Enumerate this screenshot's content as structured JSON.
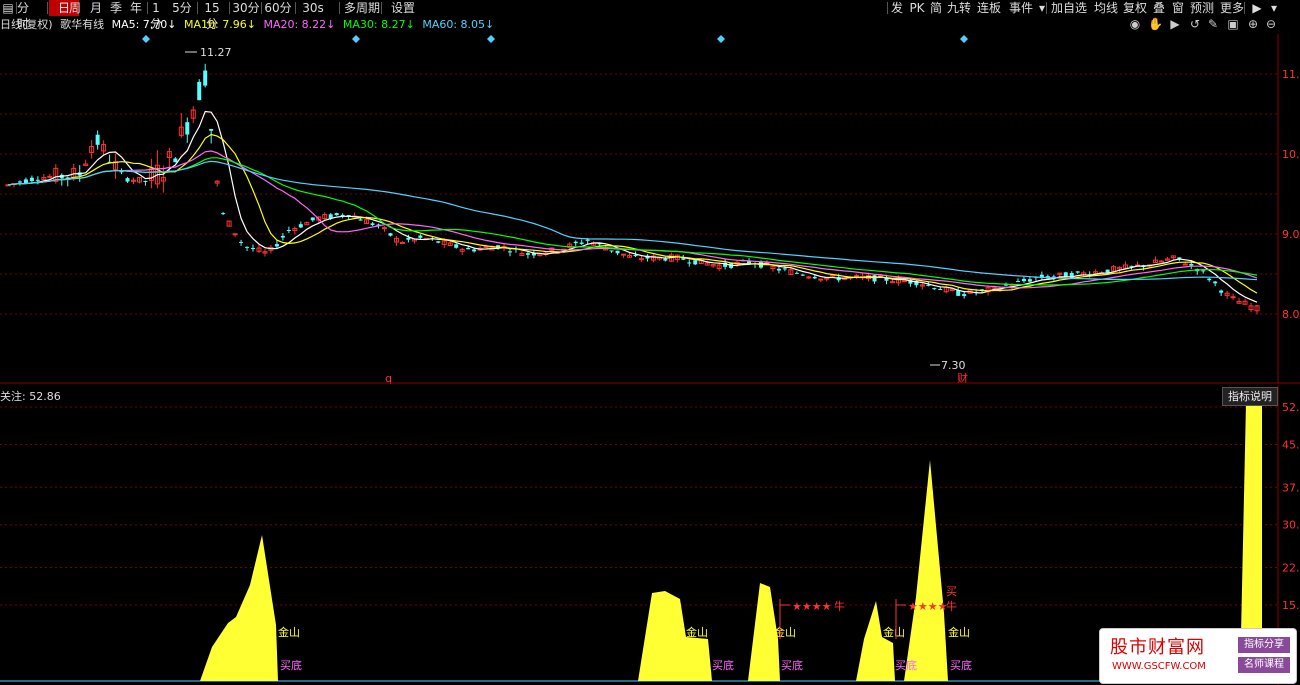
{
  "toolbar": {
    "left": [
      "分时",
      "日",
      "周",
      "月",
      "季",
      "年",
      "1分",
      "5分",
      "15分",
      "30分",
      "60分",
      "30s",
      "多周期",
      "设置"
    ],
    "active": "日",
    "right": [
      "发",
      "PK",
      "简",
      "九转",
      "连板",
      "事件",
      "加自选",
      "均线",
      "复权",
      "叠",
      "窗",
      "预测",
      "更多"
    ]
  },
  "ma_bar": {
    "title": "日线(复权)",
    "stock_name": "歌华有线",
    "ma5": "MA5: 7.70↓",
    "ma10": "MA10: 7.96↓",
    "ma20": "MA20: 8.22↓",
    "ma30": "MA30: 8.27↓",
    "ma60": "MA60: 8.05↓"
  },
  "colors": {
    "ma5": "#ffffff",
    "ma10": "#ffff00",
    "ma20": "#ff66ff",
    "ma30": "#00ff00",
    "ma60": "#4dd2ff",
    "up": "#ff3232",
    "down": "#54ffff",
    "mountain": "#ffff33"
  },
  "main_chart": {
    "y_ticks": [
      "11.0",
      "10.0",
      "9.0",
      "8.0"
    ],
    "high_label": "11.27",
    "low_label": "7.30",
    "marker_q": "q",
    "marker_cai": "财"
  },
  "sub_chart": {
    "label": "关注: 52.86",
    "indicator_button": "指标说明",
    "y_ticks": [
      "52.",
      "45.",
      "37.",
      "30.",
      "22.",
      "15."
    ],
    "annotations": {
      "jinshan": "金山",
      "maidi": "买底",
      "mai": "买",
      "niu": "牛",
      "stars": "★★★★"
    }
  },
  "watermark": {
    "title": "股市财富网",
    "url": "WWW.GSCFW.COM",
    "tag1": "指标分享",
    "tag2": "名师课程"
  }
}
